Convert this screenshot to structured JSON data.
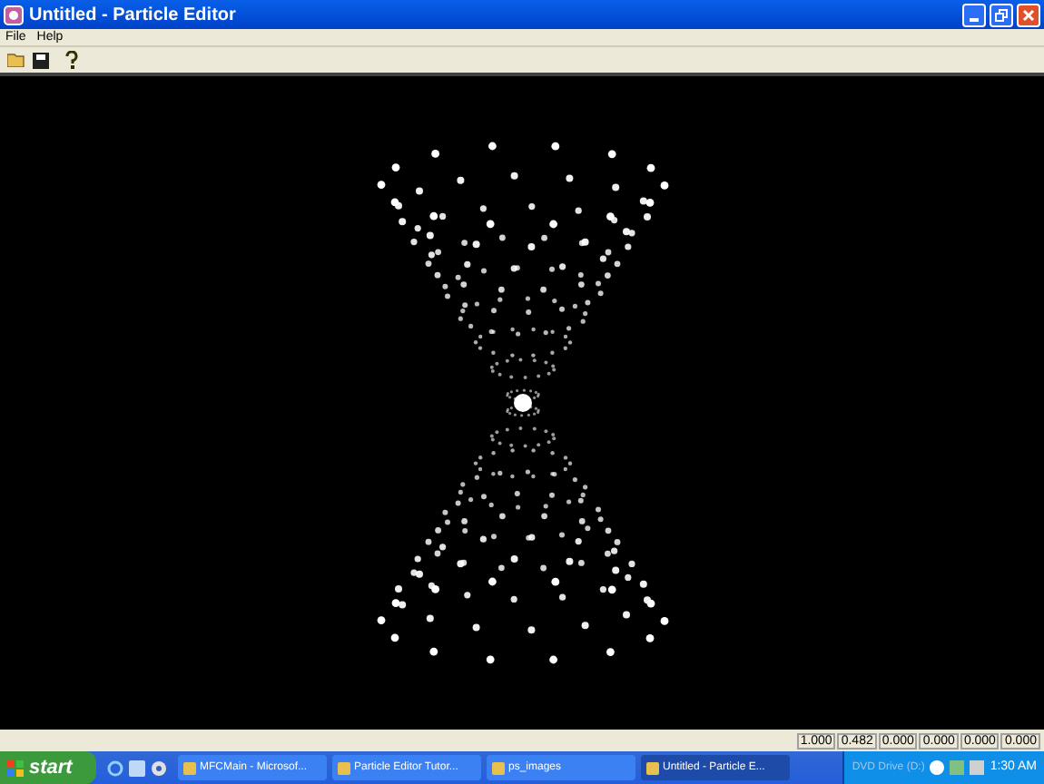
{
  "window": {
    "title": "Untitled - Particle Editor"
  },
  "menu": [
    "File",
    "Help"
  ],
  "status_bar": [
    "1.000",
    "0.482",
    "0.000",
    "0.000",
    "0.000",
    "0.000"
  ],
  "taskbar": {
    "start": "start",
    "items": [
      {
        "label": "MFCMain - Microsof...",
        "selected": false
      },
      {
        "label": "Particle Editor Tutor...",
        "selected": false
      },
      {
        "label": "ps_images",
        "selected": false
      },
      {
        "label": "Untitled - Particle E...",
        "selected": true
      }
    ],
    "tray_text": "DVD Drive (D:)",
    "clock": "1:30 AM"
  }
}
